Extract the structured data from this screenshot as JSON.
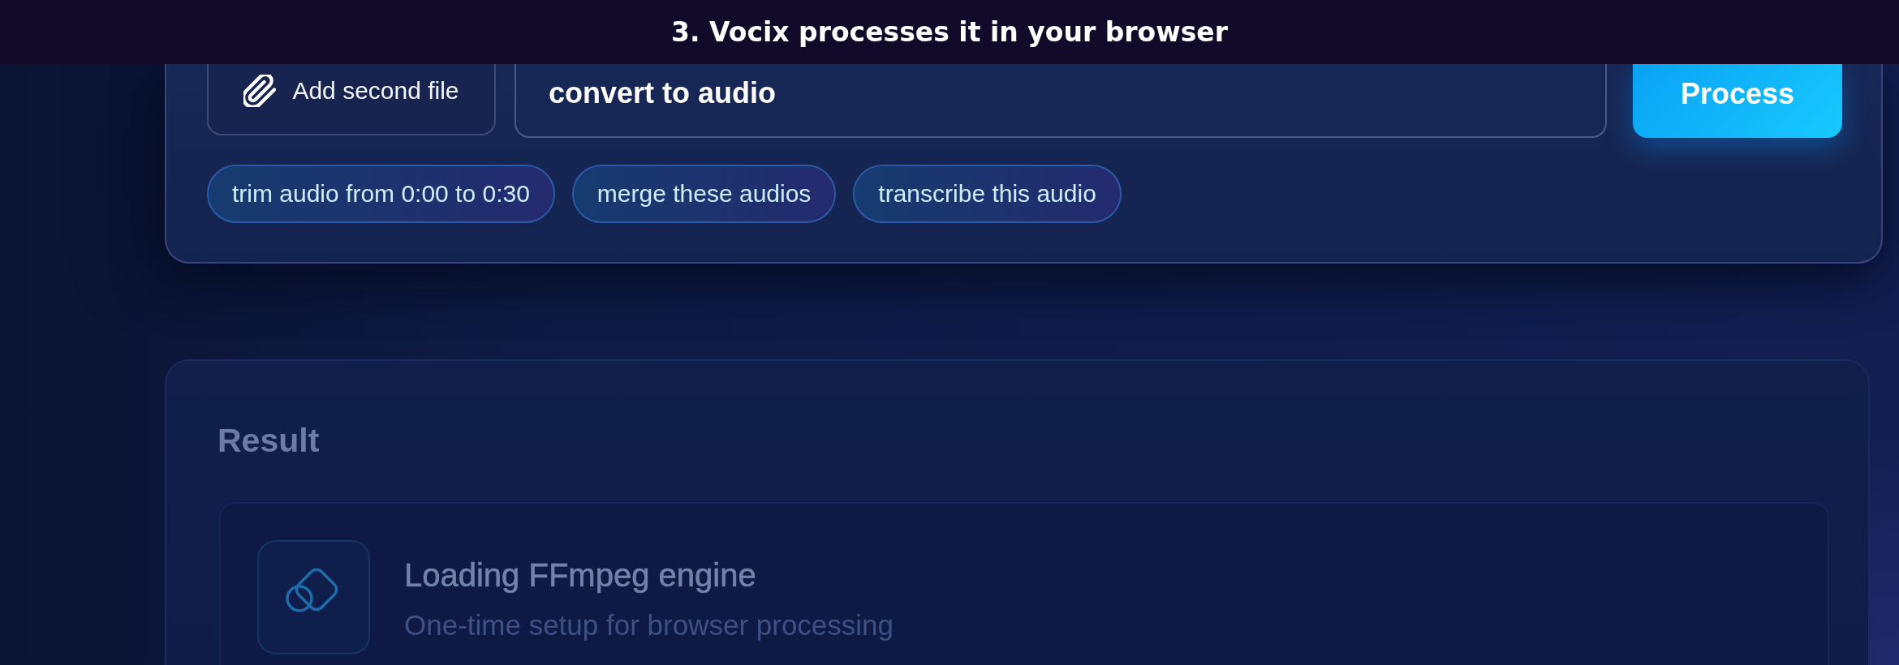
{
  "caption": {
    "text": "3. Vocix processes it in your browser"
  },
  "composer": {
    "attach_button": "Add second file",
    "prompt": {
      "value": "convert to audio"
    },
    "submit_button": "Process",
    "suggestions": [
      "trim audio from 0:00 to 0:30",
      "merge these audios",
      "transcribe this audio"
    ]
  },
  "result": {
    "title": "Result",
    "status": {
      "title": "Loading FFmpeg engine",
      "subtitle": "One-time setup for browser processing"
    }
  }
}
